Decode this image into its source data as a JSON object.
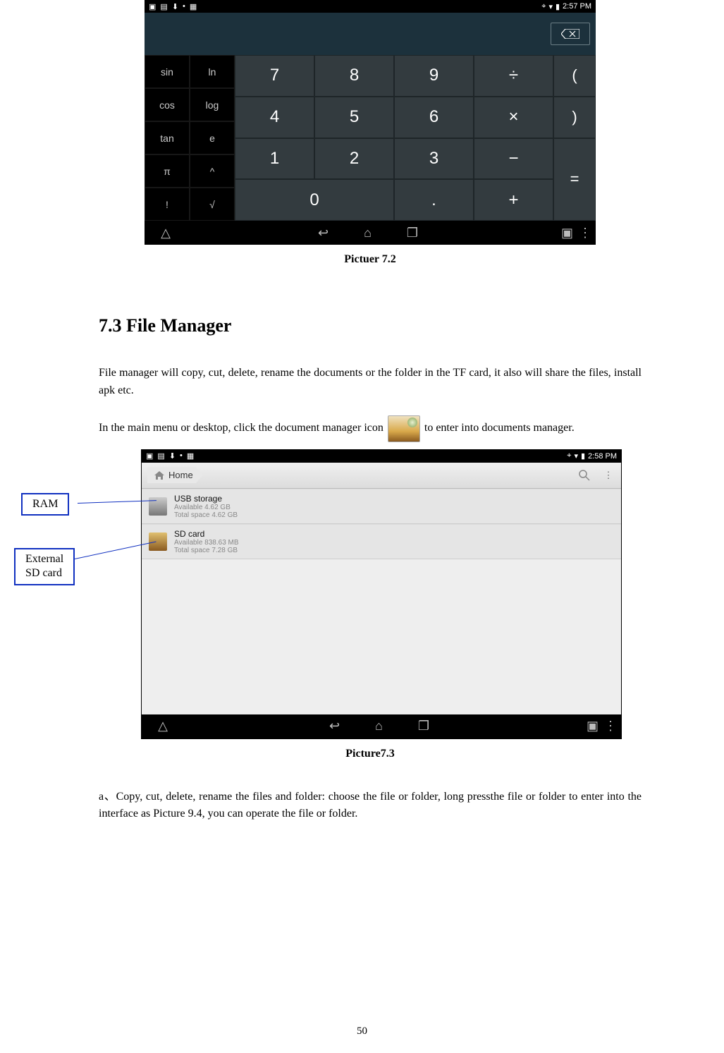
{
  "calculator": {
    "status_time": "2:57 PM",
    "fn_keys": [
      "sin",
      "ln",
      "cos",
      "log",
      "tan",
      "e",
      "π",
      "^",
      "!",
      "√"
    ],
    "num_keys": {
      "r1": [
        "7",
        "8",
        "9",
        "÷"
      ],
      "r2": [
        "4",
        "5",
        "6",
        "×"
      ],
      "r3": [
        "1",
        "2",
        "3",
        "−"
      ],
      "r4_0": "0",
      "r4_dot": ".",
      "r4_plus": "+"
    },
    "paren_open": "(",
    "paren_close": ")",
    "equals": "="
  },
  "caption_calc": "Pictuer 7.2",
  "section_title": "7.3 File Manager",
  "para1": "File manager will copy, cut, delete, rename the documents or the folder in the TF card, it also will share the files, install apk etc.",
  "para2_a": "In the main menu or desktop, click the document manager icon",
  "para2_b": "to enter into documents manager.",
  "fm": {
    "status_time": "2:58 PM",
    "home_label": "Home",
    "rows": [
      {
        "title": "USB storage",
        "line1": "Available 4.62 GB",
        "line2": "Total space 4.62 GB"
      },
      {
        "title": "SD card",
        "line1": "Available 838.63 MB",
        "line2": "Total space 7.28 GB"
      }
    ]
  },
  "anno_ram": "RAM",
  "anno_sd_l1": "External",
  "anno_sd_l2": "SD card",
  "caption_fm": "Picture7.3",
  "para3": "a、Copy, cut, delete, rename the files and folder: choose the file or folder, long pressthe file or folder to enter into the interface as Picture 9.4, you can operate the file or folder.",
  "page_number": "50"
}
